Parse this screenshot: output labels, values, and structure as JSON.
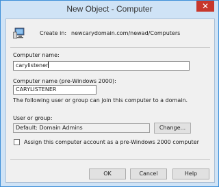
{
  "window": {
    "title": "New Object - Computer",
    "close_symbol": "✕"
  },
  "create_in": {
    "label": "Create in:",
    "path": "newcarydomain.com/newad/Computers"
  },
  "computer_name": {
    "label": "Computer name:",
    "value": "carylistener"
  },
  "pre2000_name": {
    "label": "Computer name (pre-Windows 2000):",
    "value": "CARYLISTENER"
  },
  "join_info": "The following user or group can join this computer to a domain.",
  "user_group": {
    "label": "User or group:",
    "value": "Default: Domain Admins",
    "change_button": "Change..."
  },
  "pre2000_checkbox": {
    "label": "Assign this computer account as a pre-Windows 2000 computer",
    "checked": false
  },
  "buttons": {
    "ok": "OK",
    "cancel": "Cancel",
    "help": "Help"
  },
  "icons": {
    "computer": "computer-icon"
  },
  "colors": {
    "titlebar": "#cfe3f6",
    "close": "#c7372c",
    "dialog": "#f0f0f0"
  }
}
